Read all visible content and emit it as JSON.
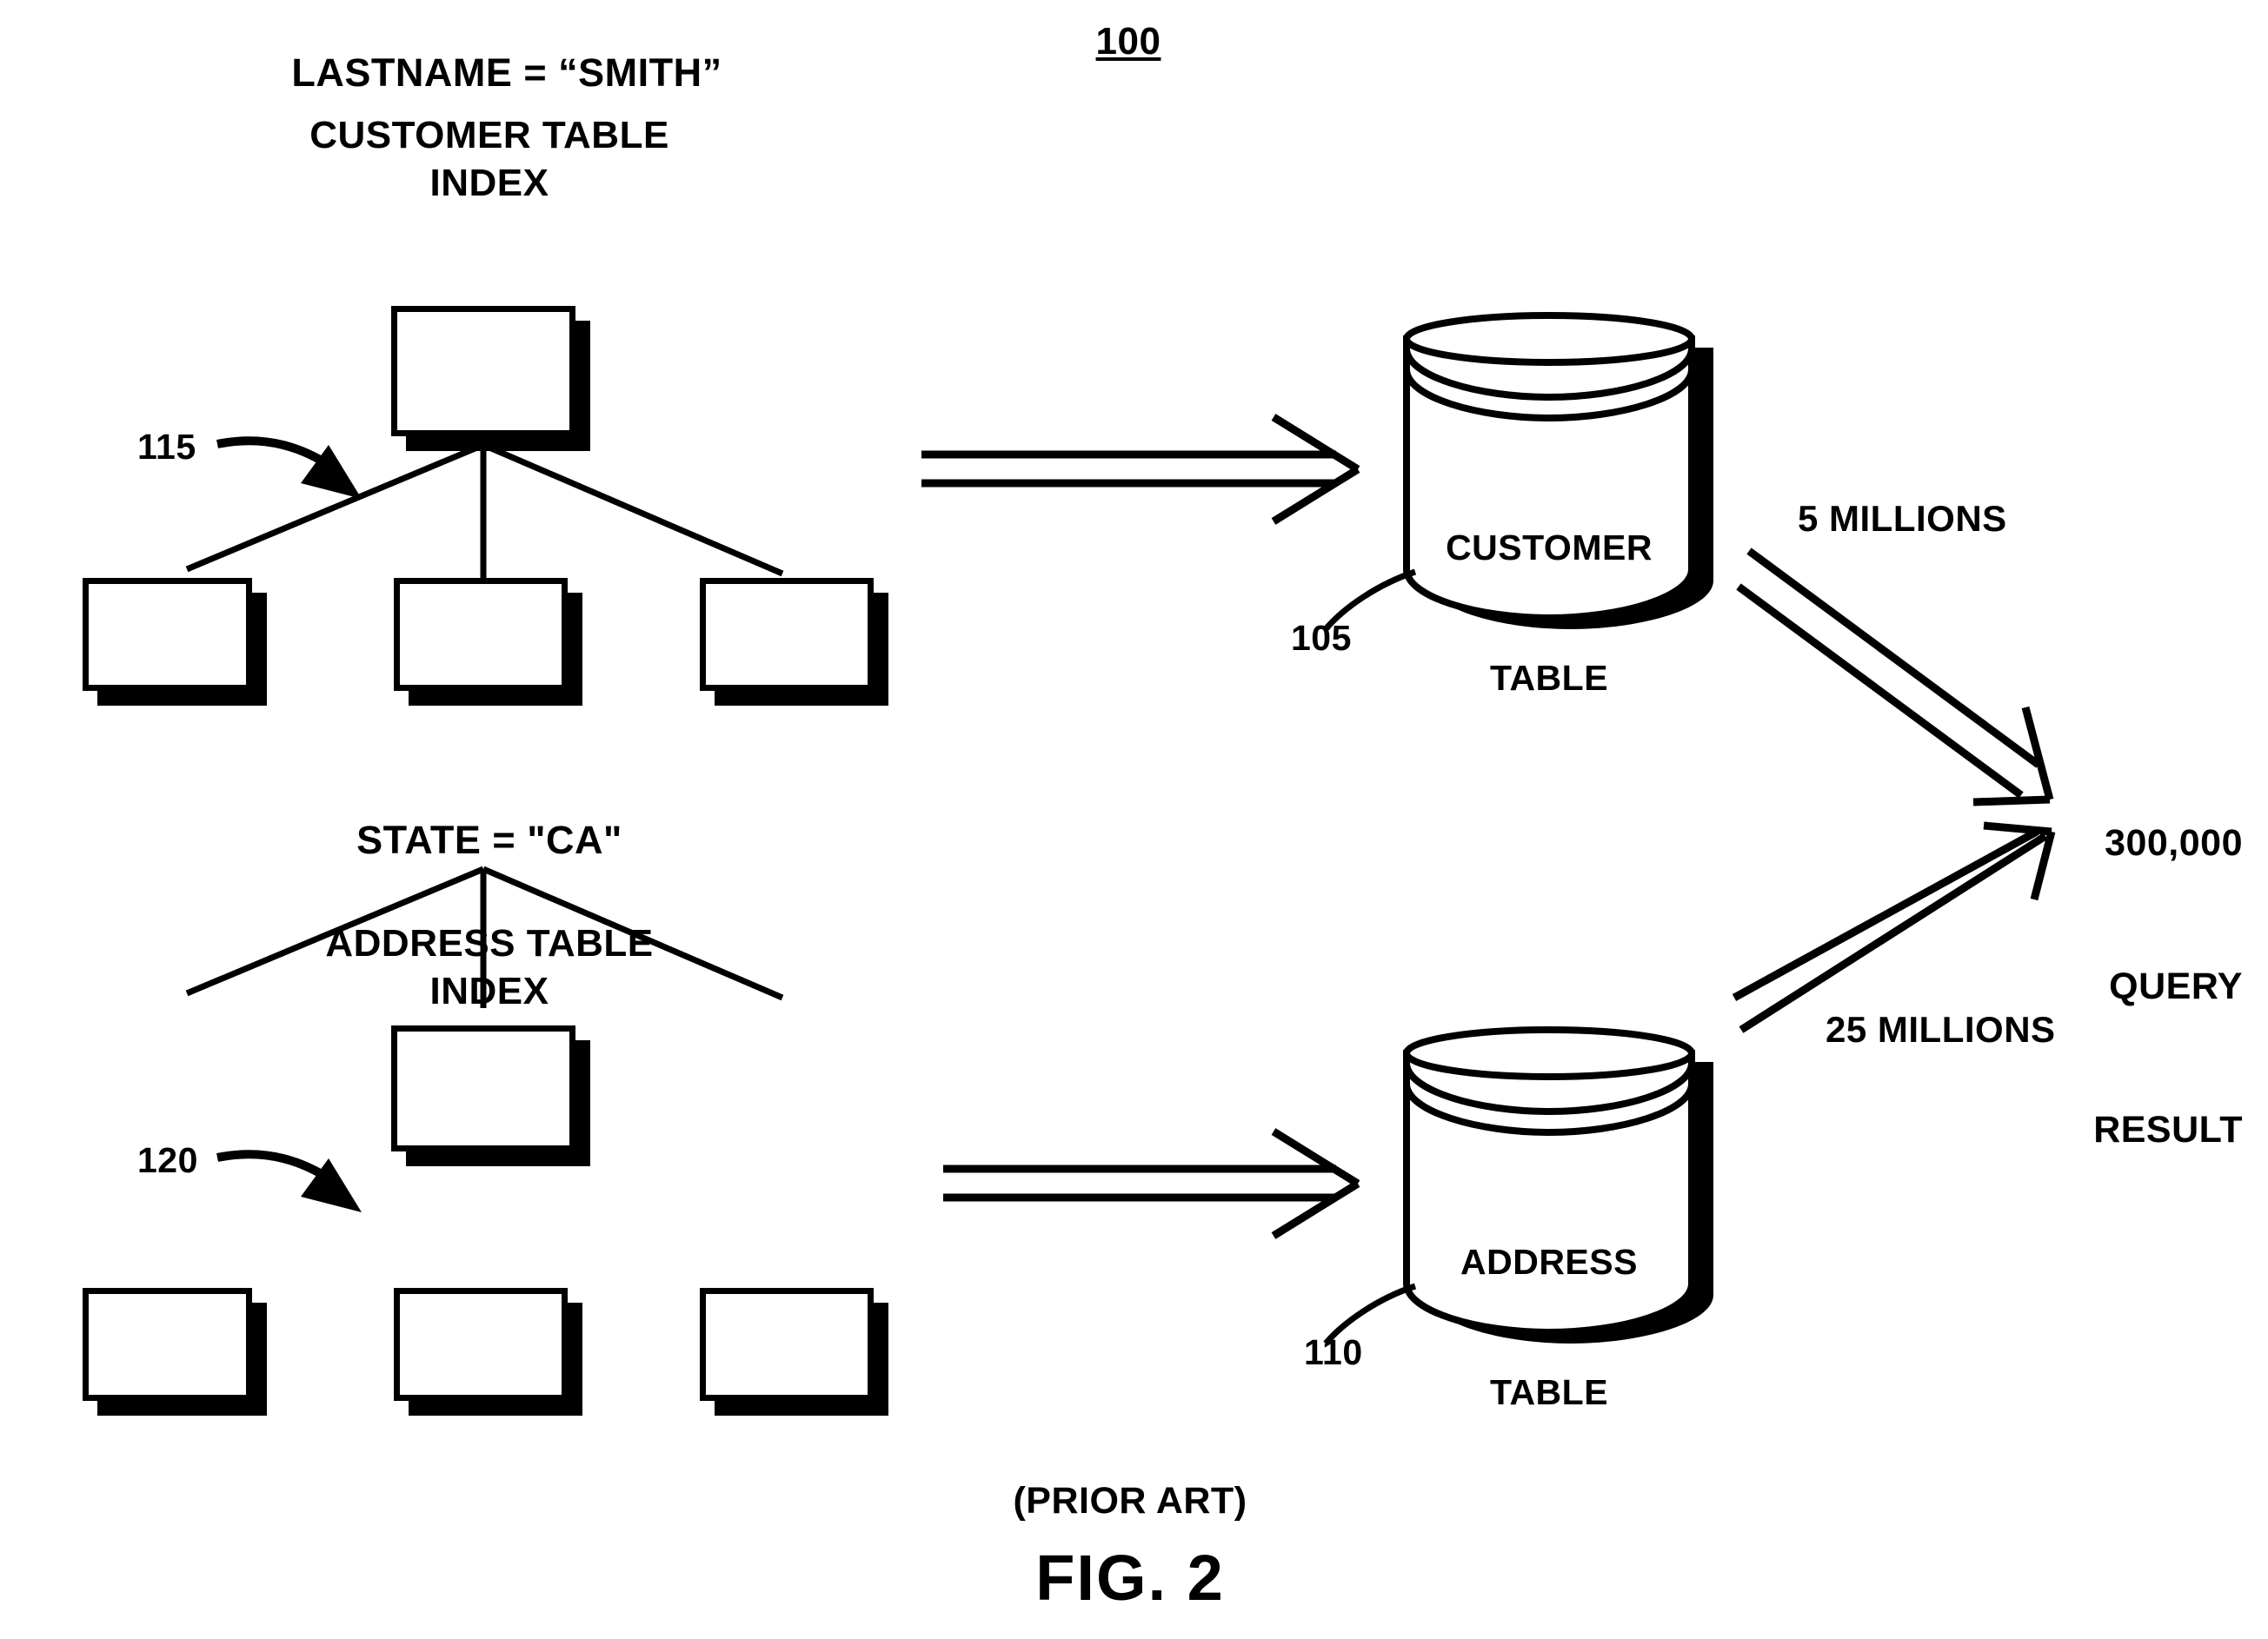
{
  "figure": {
    "number_label": "100",
    "prior_art_note": "(PRIOR ART)",
    "caption": "FIG. 2"
  },
  "customer_branch": {
    "condition": "LASTNAME = “SMITH”",
    "index_title_line1": "CUSTOMER TABLE",
    "index_title_line2": "INDEX",
    "index_ref": "115",
    "table_ref": "105",
    "table_label_line1": "CUSTOMER",
    "table_label_line2": "TABLE",
    "flow_label": "5 MILLIONS"
  },
  "address_branch": {
    "condition": "STATE = \"CA\"",
    "index_title_line1": "ADDRESS TABLE",
    "index_title_line2": "INDEX",
    "index_ref": "120",
    "table_ref": "110",
    "table_label_line1": "ADDRESS",
    "table_label_line2": "TABLE",
    "flow_label": "25 MILLIONS"
  },
  "result": {
    "count": "300,000",
    "line2": "QUERY",
    "line3": "RESULT"
  },
  "colors": {
    "ink": "#000000",
    "paper": "#ffffff"
  },
  "icons": {
    "index_tree": "tree-index-icon",
    "database": "database-cylinder-icon",
    "flow_arrow": "double-line-arrow-icon",
    "leader_arrow": "curved-leader-arrow-icon"
  }
}
